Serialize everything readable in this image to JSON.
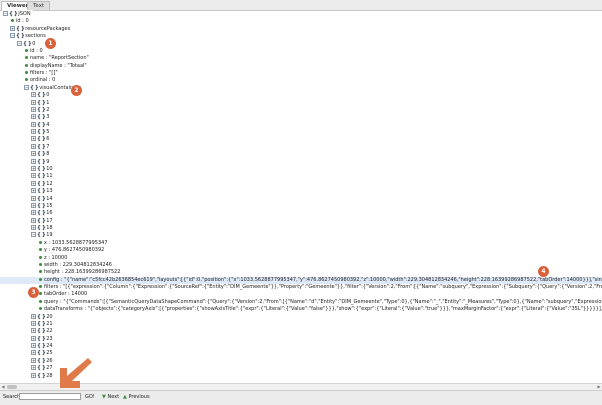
{
  "tabs": [
    {
      "label": "Viewer"
    },
    {
      "label": "Text"
    }
  ],
  "tree": [
    {
      "type": "node",
      "key": "JSON",
      "level": 0,
      "expanded": true
    },
    {
      "type": "leaf",
      "key": "id",
      "value": "0",
      "level": 1
    },
    {
      "type": "node",
      "key": "resourcePackages",
      "level": 1,
      "expanded": false
    },
    {
      "type": "node",
      "key": "sections",
      "level": 1,
      "expanded": true
    },
    {
      "type": "node",
      "key": "0",
      "level": 2,
      "expanded": true
    },
    {
      "type": "leaf",
      "key": "id",
      "value": "0",
      "level": 3
    },
    {
      "type": "leaf",
      "key": "name",
      "value": "\"ReportSection\"",
      "level": 3
    },
    {
      "type": "leaf",
      "key": "displayName",
      "value": "\"Totaal\"",
      "level": 3
    },
    {
      "type": "leaf",
      "key": "filters",
      "value": "\"[]\"",
      "level": 3
    },
    {
      "type": "leaf",
      "key": "ordinal",
      "value": "0",
      "level": 3
    },
    {
      "type": "node",
      "key": "visualContainers",
      "level": 3,
      "expanded": true
    },
    {
      "type": "node",
      "key": "0",
      "level": 4,
      "expanded": false
    },
    {
      "type": "node",
      "key": "1",
      "level": 4,
      "expanded": false
    },
    {
      "type": "node",
      "key": "2",
      "level": 4,
      "expanded": false
    },
    {
      "type": "node",
      "key": "3",
      "level": 4,
      "expanded": false
    },
    {
      "type": "node",
      "key": "4",
      "level": 4,
      "expanded": false
    },
    {
      "type": "node",
      "key": "5",
      "level": 4,
      "expanded": false
    },
    {
      "type": "node",
      "key": "6",
      "level": 4,
      "expanded": false
    },
    {
      "type": "node",
      "key": "7",
      "level": 4,
      "expanded": false
    },
    {
      "type": "node",
      "key": "8",
      "level": 4,
      "expanded": false
    },
    {
      "type": "node",
      "key": "9",
      "level": 4,
      "expanded": false
    },
    {
      "type": "node",
      "key": "10",
      "level": 4,
      "expanded": false
    },
    {
      "type": "node",
      "key": "11",
      "level": 4,
      "expanded": false
    },
    {
      "type": "node",
      "key": "12",
      "level": 4,
      "expanded": false
    },
    {
      "type": "node",
      "key": "13",
      "level": 4,
      "expanded": false
    },
    {
      "type": "node",
      "key": "14",
      "level": 4,
      "expanded": false
    },
    {
      "type": "node",
      "key": "15",
      "level": 4,
      "expanded": false
    },
    {
      "type": "node",
      "key": "16",
      "level": 4,
      "expanded": false
    },
    {
      "type": "node",
      "key": "17",
      "level": 4,
      "expanded": false
    },
    {
      "type": "node",
      "key": "18",
      "level": 4,
      "expanded": false
    },
    {
      "type": "node",
      "key": "19",
      "level": 4,
      "expanded": true
    },
    {
      "type": "leaf",
      "key": "x",
      "value": "1033.5628877995347",
      "level": 5
    },
    {
      "type": "leaf",
      "key": "y",
      "value": "476.8627450980392",
      "level": 5
    },
    {
      "type": "leaf",
      "key": "z",
      "value": "10000",
      "level": 5
    },
    {
      "type": "leaf",
      "key": "width",
      "value": "229.304812834246",
      "level": 5
    },
    {
      "type": "leaf",
      "key": "height",
      "value": "228.16399286987522",
      "level": 5
    },
    {
      "type": "leaf",
      "key": "config",
      "value": "\"{\"name\":\"c5fcc42b2636854ec619\",\"layouts\":[{\"id\":0,\"position\":{\"x\":1033.5628877995347,\"y\":476.8627450980392,\"z\":10000,\"width\":229.304812834246,\"height\":228.16399286987522,\"tabOrder\":14000}}],\"singleVisual\":{\"visualType\":\"clusteredBarChart\",\"projections\":",
      "level": 5,
      "selected": true
    },
    {
      "type": "leaf",
      "key": "filters",
      "value": "\"[{\"expression\":{\"Column\":{\"Expression\":{\"SourceRef\":{\"Entity\":\"DIM_Gemeente\"}},\"Property\":\"Gemeente\"}},\"filter\":{\"Version\":2,\"From\":[{\"Name\":\"subquery\",\"Expression\":{\"Subquery\":{\"Query\":{\"Version\":2,\"From\":[{\"Name\":\"d\",\"Entity\":\"DIM_Gemeente\",\"Type\":0}",
      "level": 5
    },
    {
      "type": "leaf",
      "key": "tabOrder",
      "value": "14000",
      "level": 5
    },
    {
      "type": "leaf",
      "key": "query",
      "value": "\"{\"Commands\":[{\"SemanticQueryDataShapeCommand\":{\"Query\":{\"Version\":2,\"From\":[{\"Name\":\"d\",\"Entity\":\"DIM_Gemeente\",\"Type\":0},{\"Name\":\"_\",\"Entity\":\"_Measures\",\"Type\":0},{\"Name\":\"subquery\",\"Expression\":{\"Subquery\":{\"Query\":{\"Version\":2,\"From\":[{\"Name\":\"d\",\"Entity\":\"DIM_Gemeente\",\"Type\":0}",
      "level": 5
    },
    {
      "type": "leaf",
      "key": "dataTransforms",
      "value": "\"{\"objects\":{\"categoryAxis\":[{\"properties\":{\"showAxisTitle\":{\"expr\":{\"Literal\":{\"Value\":\"false\"}}},\"show\":{\"expr\":{\"Literal\":{\"Value\":\"true\"}}},\"maxMarginFactor\":{\"expr\":{\"Literal\":{\"Value\":\"35L\"}}}}}],\"valueAxis\":[{\"properties\":{\"showAxisTitle\":{\"expr\":{\"Literal\":{\"Value\":",
      "level": 5
    },
    {
      "type": "node",
      "key": "20",
      "level": 4,
      "expanded": false
    },
    {
      "type": "node",
      "key": "21",
      "level": 4,
      "expanded": false
    },
    {
      "type": "node",
      "key": "22",
      "level": 4,
      "expanded": false
    },
    {
      "type": "node",
      "key": "23",
      "level": 4,
      "expanded": false
    },
    {
      "type": "node",
      "key": "24",
      "level": 4,
      "expanded": false
    },
    {
      "type": "node",
      "key": "25",
      "level": 4,
      "expanded": false
    },
    {
      "type": "node",
      "key": "26",
      "level": 4,
      "expanded": false
    },
    {
      "type": "node",
      "key": "27",
      "level": 4,
      "expanded": false
    },
    {
      "type": "node",
      "key": "28",
      "level": 4,
      "expanded": false
    }
  ],
  "badges": [
    "1",
    "2",
    "3",
    "4"
  ],
  "search": {
    "label": "Search:",
    "value": "",
    "go_label": "GO!",
    "next_label": "Next",
    "previous_label": "Previous"
  },
  "colors": {
    "badge": "#d9623b",
    "arrow": "#e07a48",
    "leaf_dot": "#3d8b3d",
    "selected_row": "#dfe9f7"
  }
}
